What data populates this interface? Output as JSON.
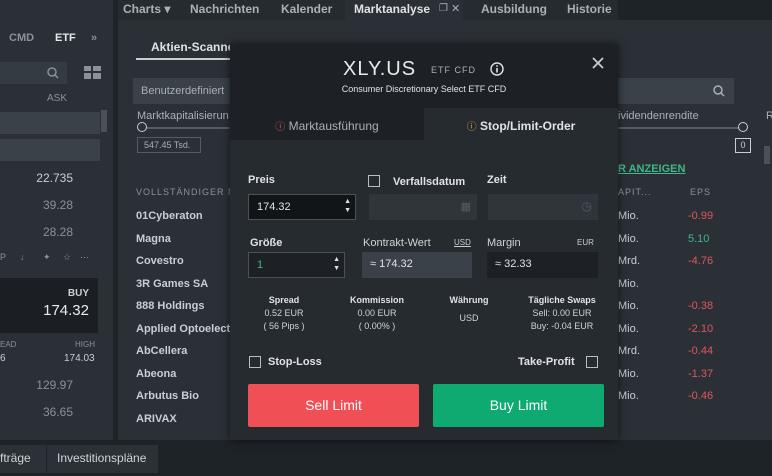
{
  "left_panel": {
    "tabs": [
      "CMD",
      "ETF"
    ],
    "more": "»",
    "ask_header": "ASK",
    "prices": [
      "22.735",
      "39.28",
      "28.28"
    ],
    "tool_labels": [
      "P",
      "↓",
      "✦",
      "☆",
      "⋯"
    ],
    "buy_label": "BUY",
    "buy_price": "174.32",
    "spread_label": "EAD",
    "high_label": "HIGH",
    "spread_value": "6",
    "high_value": "174.03",
    "bottom_prices": [
      "129.97",
      "36.65"
    ]
  },
  "top_tabs": [
    "Charts",
    "Nachrichten",
    "Kalender",
    "Marktanalyse",
    "Ausbildung",
    "Historie"
  ],
  "bottom_tabs": [
    "fträge",
    "Investitionspläne"
  ],
  "screener": {
    "tab_active": "Aktien-Scanne",
    "tab_other": "",
    "dropdown": "Benutzerdefiniert",
    "filter_label": "Marktkapitalisierun",
    "filter_value": "547.45 Tsd.",
    "dividend_label": "ividendenrendite",
    "dividend_value": "0",
    "r_label": "R",
    "show_more": "R ANZEIGEN",
    "list_header": "VOLLSTÄNDIGER N",
    "capital_header": "APIT...",
    "eps_header": "EPS",
    "rows": [
      {
        "name": "01Cyberaton",
        "cap": "Mio.",
        "eps": "-0.99",
        "color": "#e0575b"
      },
      {
        "name": "Magna",
        "cap": "Mio.",
        "eps": "5.10",
        "color": "#3fb68b"
      },
      {
        "name": "Covestro",
        "cap": "Mrd.",
        "eps": "-4.76",
        "color": "#e0575b"
      },
      {
        "name": "3R Games SA",
        "cap": "Mio.",
        "eps": "",
        "color": "#e0575b"
      },
      {
        "name": "888 Holdings",
        "cap": "Mio.",
        "eps": "-0.38",
        "color": "#e0575b"
      },
      {
        "name": "Applied Optoelect",
        "cap": "Mio.",
        "eps": "-2.10",
        "color": "#e0575b"
      },
      {
        "name": "AbCellera",
        "cap": "Mrd.",
        "eps": "-0.44",
        "color": "#e0575b"
      },
      {
        "name": "Abeona",
        "cap": "Mio.",
        "eps": "-1.37",
        "color": "#e0575b"
      },
      {
        "name": "Arbutus Bio",
        "cap": "Mio.",
        "eps": "-0.46",
        "color": "#e0575b"
      },
      {
        "name": "ARIVAX",
        "cap": "",
        "eps": "",
        "color": "#e0575b"
      }
    ]
  },
  "order": {
    "symbol": "XLY.US",
    "instrument_type": "ETF CFD",
    "description": "Consumer Discretionary Select ETF CFD",
    "tab_market": "Marktausführung",
    "tab_limit": "Stop/Limit-Order",
    "price_label": "Preis",
    "price_value": "174.32",
    "expiry_label": "Verfallsdatum",
    "time_label": "Zeit",
    "size_label": "Größe",
    "size_value": "1",
    "contract_label": "Kontrakt-Wert",
    "contract_currency": "USD",
    "contract_value": "≈ 174.32",
    "margin_label": "Margin",
    "margin_currency": "EUR",
    "margin_value": "≈ 32.33",
    "spread_title": "Spread",
    "spread_value": "0.52 EUR",
    "spread_pips": "( 56 Pips )",
    "commission_title": "Kommission",
    "commission_value": "0.00 EUR",
    "commission_pct": "( 0.00% )",
    "currency_title": "Währung",
    "currency_value": "USD",
    "swap_title": "Tägliche Swaps",
    "swap_sell": "Sell: 0.00 EUR",
    "swap_buy": "Buy: -0.04 EUR",
    "stop_loss_label": "Stop-Loss",
    "take_profit_label": "Take-Profit",
    "sell_button": "Sell Limit",
    "buy_button": "Buy Limit",
    "sell_color": "#f04f56",
    "buy_color": "#0eaa71"
  }
}
